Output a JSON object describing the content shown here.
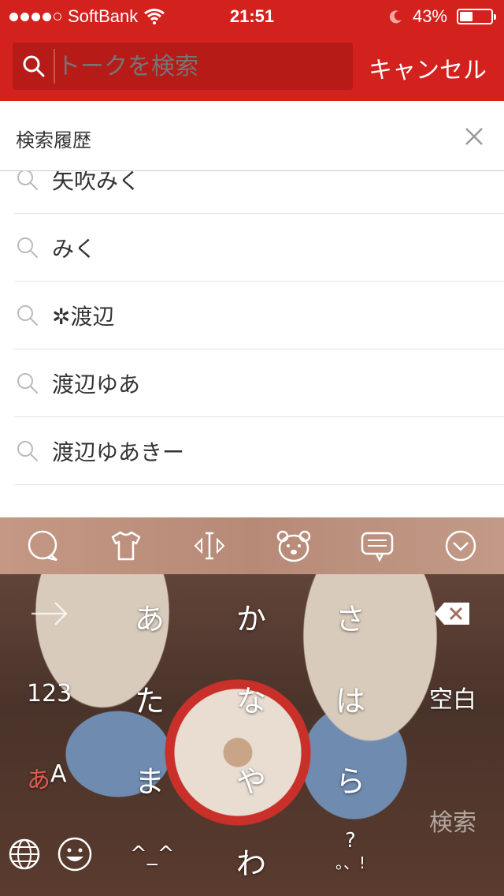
{
  "status_bar": {
    "carrier": "SoftBank",
    "time": "21:51",
    "battery": "43%",
    "battery_level": 0.43
  },
  "search": {
    "placeholder": "トークを検索",
    "cancel_label": "キャンセル"
  },
  "history": {
    "title": "検索履歴",
    "items": [
      {
        "label": "矢吹みく"
      },
      {
        "label": "みく"
      },
      {
        "label": "✲渡辺"
      },
      {
        "label": "渡辺ゆあ"
      },
      {
        "label": "渡辺ゆあきー"
      }
    ]
  },
  "keyboard": {
    "keys": {
      "a": "あ",
      "ka": "か",
      "sa": "さ",
      "ta": "た",
      "na": "な",
      "ha": "は",
      "ma": "ま",
      "ya": "や",
      "ra": "ら",
      "wa": "わ",
      "num": "123",
      "space": "空白",
      "mode_a": "あ",
      "mode_A": "A",
      "search": "検索",
      "emoticon": "^_^",
      "punct_top": "?",
      "punct_bottom": "。、!"
    },
    "accent_color": "#e05a4e"
  }
}
